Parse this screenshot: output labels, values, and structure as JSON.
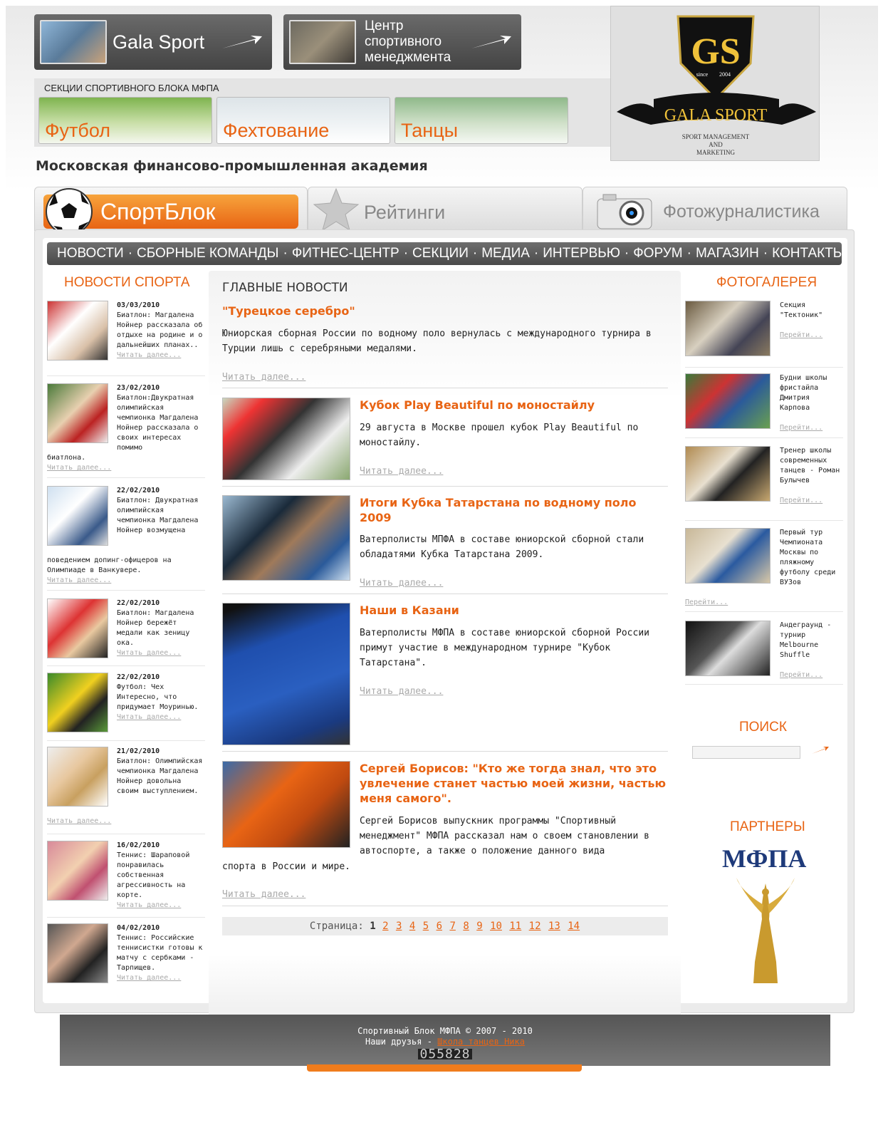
{
  "top_buttons": {
    "gala": {
      "label": "Gala Sport"
    },
    "center": {
      "line1": "Центр",
      "line2": "спортивного",
      "line3": "менеджмента"
    }
  },
  "sections": {
    "caption": "СЕКЦИИ СПОРТИВНОГО БЛОКА МФПА",
    "items": [
      "Футбол",
      "Фехтование",
      "Танцы"
    ]
  },
  "logo": {
    "initials": "GS",
    "since": "since",
    "year": "2004",
    "ribbon": "GALA SPORT",
    "sub1": "SPORT MANAGEMENT",
    "sub2": "AND",
    "sub3": "MARKETING"
  },
  "academy": "Московская финансово-промышленная академия",
  "tabs": [
    "СпортБлок",
    "Рейтинги",
    "Фотожурналистика"
  ],
  "nav": [
    "НОВОСТИ",
    "СБОРНЫЕ КОМАНДЫ",
    "ФИТНЕС-ЦЕНТР",
    "СЕКЦИИ",
    "МЕДИА",
    "ИНТЕРВЬЮ",
    "ФОРУМ",
    "МАГАЗИН",
    "КОНТАКТЫ"
  ],
  "left": {
    "title": "НОВОСТИ СПОРТА",
    "more": "Читать далее...",
    "items": [
      {
        "date": "03/03/2010",
        "text": "Биатлон: Магдалена Нойнер рассказала об отдыхе на родине и о дальнейших планах.."
      },
      {
        "date": "23/02/2010",
        "text": "Биатлон:Двукратная олимпийская чемпионка Магдалена Нойнер рассказала о своих интересах помимо",
        "tail": "биатлона."
      },
      {
        "date": "22/02/2010",
        "text": "Биатлон: Двукратная олимпийская чемпионка Магдалена Нойнер возмущена",
        "tail": "поведением допинг-офицеров на Олимпиаде в Ванкувере."
      },
      {
        "date": "22/02/2010",
        "text": "Биатлон: Магдалена Нойнер бережёт медали как зеницу ока."
      },
      {
        "date": "22/02/2010",
        "text": "Футбол: Чех Интересно, что придумает Моуринью."
      },
      {
        "date": "21/02/2010",
        "text": "Биатлон: Олимпийская чемпионка Магдалена Нойнер довольна своим выступлением."
      },
      {
        "date": "16/02/2010",
        "text": "Теннис: Шараповой понравилась собственная агрессивность на корте."
      },
      {
        "date": "04/02/2010",
        "text": "Теннис: Российские теннисистки готовы к матчу с сербками - Тарпищев."
      }
    ]
  },
  "center": {
    "title": "ГЛАВНЫЕ НОВОСТИ",
    "more": "Читать далее...",
    "news": [
      {
        "title": "\"Турецкое серебро\"",
        "text": "Юниорская сборная России по водному поло вернулась с международного турнира в Турции лишь с серебряными медалями."
      },
      {
        "title": "Кубок Play Beautiful по моностайлу",
        "text": "29 августа в Москве прошел кубок Play Beautiful по моностайлу."
      },
      {
        "title": "Итоги Кубка Татарстана по водному поло 2009",
        "text": "Ватерполисты МПФА в составе юниорской сборной стали обладатями Кубка Татарстана 2009."
      },
      {
        "title": "Наши в Казани",
        "text": "Ватерполисты МФПА в составе юниорской сборной России примут участие в международном турнире \"Кубок Татарстана\"."
      },
      {
        "title": "Сергей Борисов: \"Кто же тогда знал, что это увлечение станет частью моей жизни, частью меня самого\".",
        "text": "Сергей Борисов выпускник программы \"Спортивный менеджмент\" МФПА рассказал нам о своем становлении в автоспорте, а также о положение данного вида",
        "tail": "спорта в России и мире."
      }
    ],
    "pager": {
      "label": "Страница:",
      "current": "1",
      "pages": [
        "2",
        "3",
        "4",
        "5",
        "6",
        "7",
        "8",
        "9",
        "10",
        "11",
        "12",
        "13",
        "14"
      ]
    }
  },
  "right": {
    "gallery_title": "ФОТОГАЛЕРЕЯ",
    "link": "Перейти...",
    "items": [
      "Секция \"Тектоник\"",
      "Будни школы фристайла Дмитрия Карпова",
      "Тренер школы современных танцев - Роман Булычев",
      "Первый тур Чемпионата Москвы по пляжному футболу среди ВУЗов",
      "Андеграунд - турнир Melbourne Shuffle"
    ],
    "search_title": "ПОИСК",
    "search_value": "",
    "partners_title": "ПАРТНЕРЫ",
    "partner_name": "МФПА"
  },
  "footer": {
    "copyright": "Спортивный Блок МФПА © 2007 - 2010",
    "friends": "Наши друзья -",
    "friends_link": "Школа танцев Ника",
    "counter": "055828"
  },
  "colors": {
    "accent": "#e86414",
    "nav_bg": "#5a5a5a",
    "orange_tab": "#f07c1c"
  }
}
